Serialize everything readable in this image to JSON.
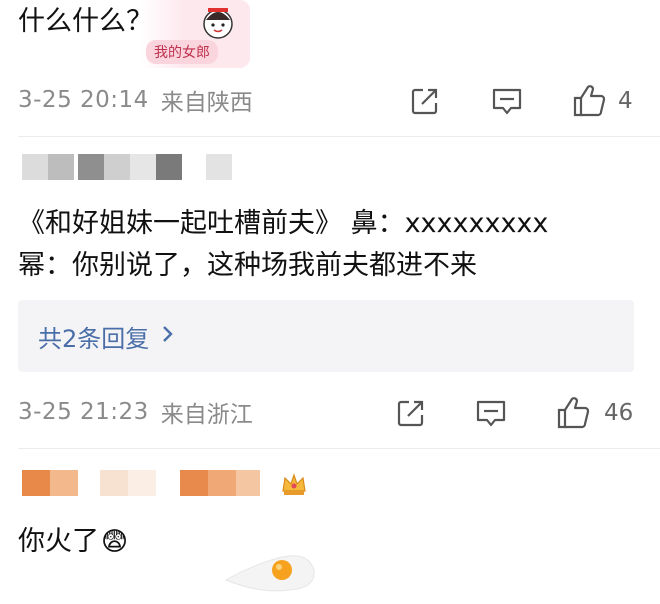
{
  "comments": [
    {
      "text": "什么什么？",
      "sticker_text": "我的女郎",
      "time": "3-25 20:14",
      "location": "来自陕西",
      "likes": "4"
    },
    {
      "text_line1": "《和好姐妹一起吐槽前夫》  鼻：xxxxxxxxx",
      "text_line2": "幂：你别说了，这种场我前夫都进不来",
      "replies_label": "共2条回复",
      "time": "3-25 21:23",
      "location": "来自浙江",
      "likes": "46"
    },
    {
      "text": "你火了",
      "emoji": "😨"
    }
  ],
  "icons": {
    "share": "share-icon",
    "comment": "comment-icon",
    "like": "thumbs-up-icon",
    "chevron": "chevron-right-icon",
    "crown": "crown-icon"
  },
  "colors": {
    "meta_text": "#8a8a8a",
    "link": "#4a6ea8",
    "reply_bg": "#f4f4f6"
  }
}
